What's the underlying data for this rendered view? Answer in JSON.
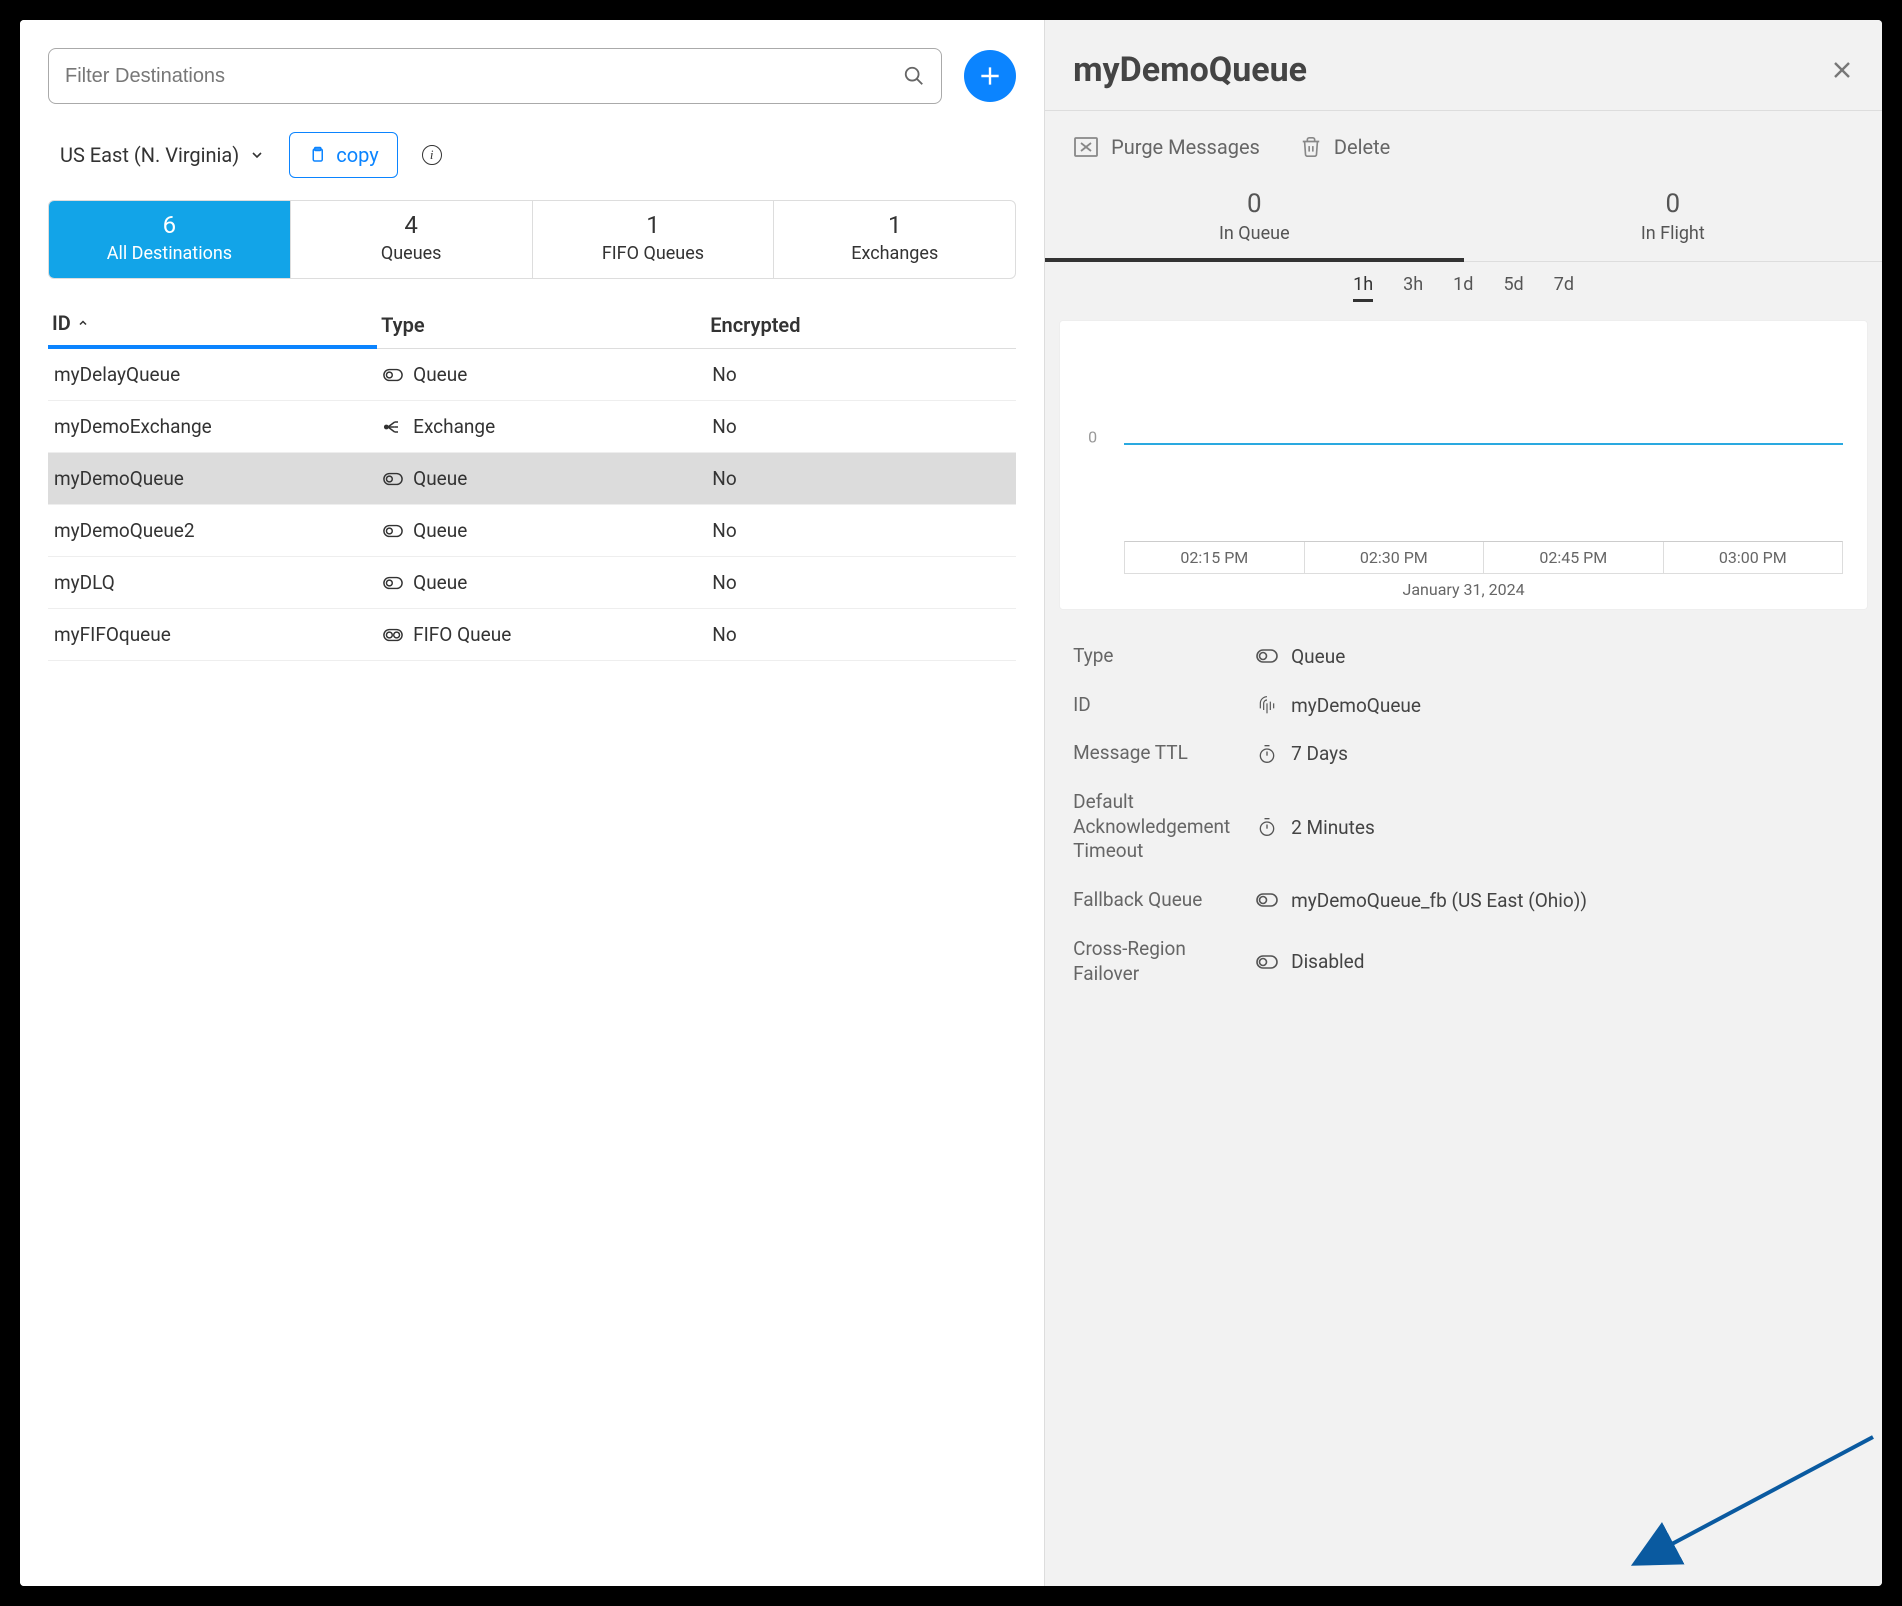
{
  "filter": {
    "placeholder": "Filter Destinations"
  },
  "region": {
    "label": "US East (N. Virginia)"
  },
  "copy_label": "copy",
  "stats": [
    {
      "count": "6",
      "label": "All Destinations",
      "active": true
    },
    {
      "count": "4",
      "label": "Queues"
    },
    {
      "count": "1",
      "label": "FIFO Queues"
    },
    {
      "count": "1",
      "label": "Exchanges"
    }
  ],
  "table": {
    "headers": {
      "id": "ID",
      "type": "Type",
      "encrypted": "Encrypted"
    },
    "sort_col": "id",
    "rows": [
      {
        "id": "myDelayQueue",
        "type": "Queue",
        "encrypted": "No",
        "icon": "queue"
      },
      {
        "id": "myDemoExchange",
        "type": "Exchange",
        "encrypted": "No",
        "icon": "exchange"
      },
      {
        "id": "myDemoQueue",
        "type": "Queue",
        "encrypted": "No",
        "icon": "queue",
        "selected": true
      },
      {
        "id": "myDemoQueue2",
        "type": "Queue",
        "encrypted": "No",
        "icon": "queue"
      },
      {
        "id": "myDLQ",
        "type": "Queue",
        "encrypted": "No",
        "icon": "queue"
      },
      {
        "id": "myFIFOqueue",
        "type": "FIFO Queue",
        "encrypted": "No",
        "icon": "fifo"
      }
    ]
  },
  "detail": {
    "title": "myDemoQueue",
    "actions": {
      "purge": "Purge Messages",
      "delete": "Delete"
    },
    "metrics": {
      "in_queue": {
        "value": "0",
        "label": "In Queue"
      },
      "in_flight": {
        "value": "0",
        "label": "In Flight"
      }
    },
    "time_range": {
      "options": [
        "1h",
        "3h",
        "1d",
        "5d",
        "7d"
      ],
      "active": "1h"
    },
    "chart_date": "January 31, 2024",
    "props": {
      "type": {
        "label": "Type",
        "value": "Queue"
      },
      "id": {
        "label": "ID",
        "value": "myDemoQueue"
      },
      "ttl": {
        "label": "Message TTL",
        "value": "7 Days"
      },
      "ack": {
        "label": "Default Acknowledgement Timeout",
        "value": "2 Minutes"
      },
      "fallback": {
        "label": "Fallback Queue",
        "value": "myDemoQueue_fb (US East (Ohio))"
      },
      "failover": {
        "label": "Cross-Region Failover",
        "value": "Disabled"
      }
    }
  },
  "chart_data": {
    "type": "line",
    "title": "",
    "xlabel": "",
    "ylabel": "",
    "x_ticks": [
      "02:15 PM",
      "02:30 PM",
      "02:45 PM",
      "03:00 PM"
    ],
    "y_ticks": [
      "0"
    ],
    "ylim": [
      0,
      0
    ],
    "series": [
      {
        "name": "In Queue",
        "values": [
          0,
          0,
          0,
          0
        ]
      }
    ],
    "categories": [
      "02:15 PM",
      "02:30 PM",
      "02:45 PM",
      "03:00 PM"
    ],
    "date_label": "January 31, 2024"
  }
}
